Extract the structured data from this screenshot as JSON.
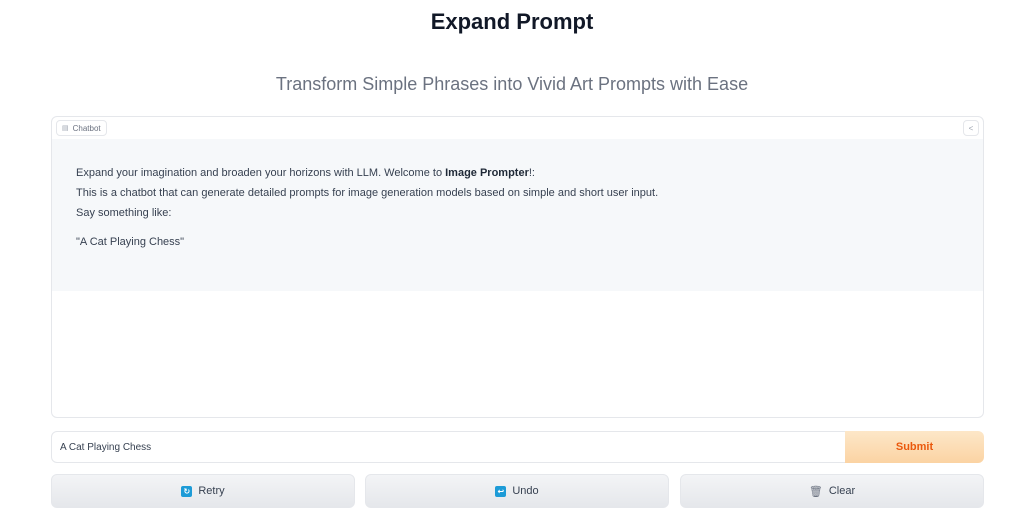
{
  "header": {
    "title": "Expand Prompt",
    "subtitle": "Transform Simple Phrases into Vivid Art Prompts with Ease"
  },
  "chatbot": {
    "label": "Chatbot",
    "label_icon": "chat-icon",
    "share_icon": "share-icon",
    "message": {
      "line1_prefix": "Expand your imagination and broaden your horizons with LLM. Welcome to ",
      "line1_bold": "Image Prompter",
      "line1_suffix": "!:",
      "line2": "This is a chatbot that can generate detailed prompts for image generation models based on simple and short user input.",
      "line3": "Say something like:",
      "example": "\"A Cat Playing Chess\""
    }
  },
  "input": {
    "value": "A Cat Playing Chess"
  },
  "submit": {
    "label": "Submit"
  },
  "buttons": [
    {
      "label": "Retry",
      "icon": "retry-icon"
    },
    {
      "label": "Undo",
      "icon": "undo-icon"
    },
    {
      "label": "Clear",
      "icon": "trash-icon"
    }
  ],
  "colors": {
    "accent": "#ea580c",
    "submit_bg": "#fbd3a3",
    "icon_blue": "#1d9bd7"
  }
}
